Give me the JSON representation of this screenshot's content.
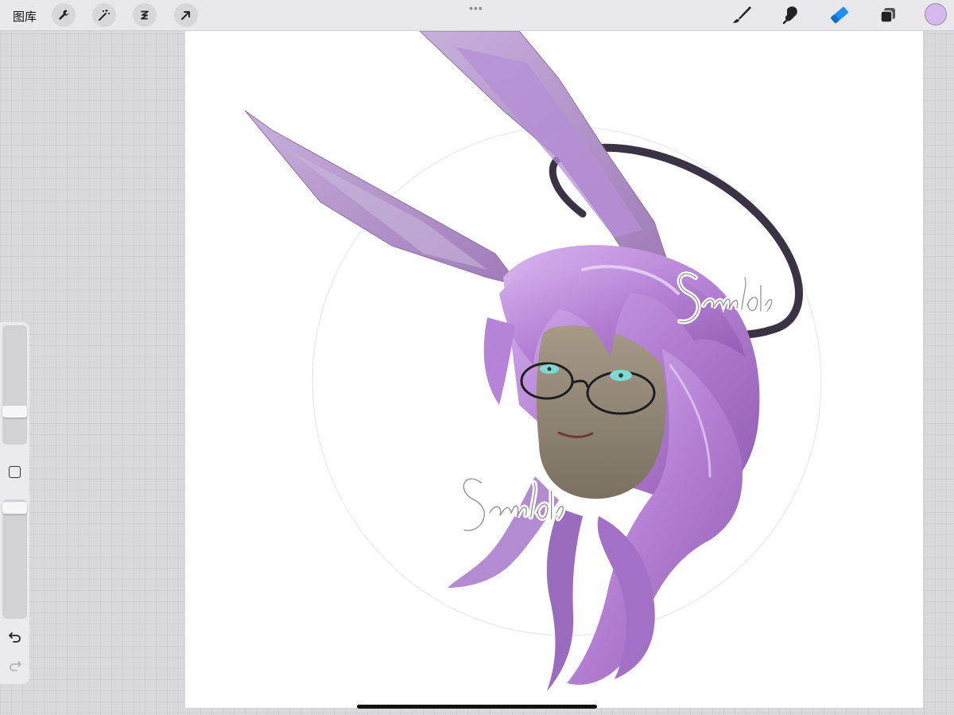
{
  "topbar": {
    "gallery_label": "图库",
    "left_tools": [
      "wrench-icon",
      "magic-wand-icon",
      "selection-icon",
      "transform-arrow-icon"
    ],
    "more_dots": "•••",
    "right_tools": [
      "brush-icon",
      "smudge-icon",
      "eraser-icon",
      "layers-icon"
    ],
    "active_tool": "eraser-icon",
    "current_color": "#d7b8ee"
  },
  "sidebar": {
    "brush_size_level": 0.7,
    "opacity_level": 0.03
  },
  "canvas": {
    "watermarks": [
      "Sample",
      "Sample"
    ]
  },
  "colors": {
    "accent": "#1c8ff0",
    "hair": "#b887d6",
    "halo": "#3a3344"
  }
}
